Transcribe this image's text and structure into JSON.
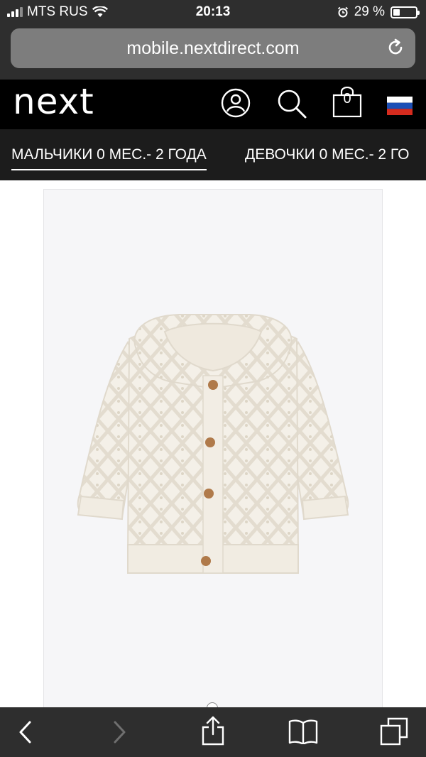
{
  "status_bar": {
    "carrier": "MTS RUS",
    "time": "20:13",
    "battery_percent": "29 %",
    "battery_level": 0.29
  },
  "browser": {
    "url": "mobile.nextdirect.com"
  },
  "header": {
    "logo": "next",
    "bag_count": "0",
    "icons": [
      "account-icon",
      "search-icon",
      "bag-icon",
      "russia-flag-icon"
    ]
  },
  "tabs": [
    {
      "label": "МАЛЬЧИКИ 0 МЕС.- 2 ГОДА",
      "active": true
    },
    {
      "label": "ДЕВОЧКИ 0 МЕС.- 2 ГО",
      "active": false
    }
  ],
  "product": {
    "image": "white-knitted-hooded-cardigan"
  },
  "toolbar": {
    "icons": [
      "back-icon",
      "forward-icon",
      "share-icon",
      "bookmarks-icon",
      "tabs-icon"
    ]
  },
  "colors": {
    "chrome": "#2e2e2e",
    "header": "#000000",
    "tabs": "#1c1c1c"
  }
}
